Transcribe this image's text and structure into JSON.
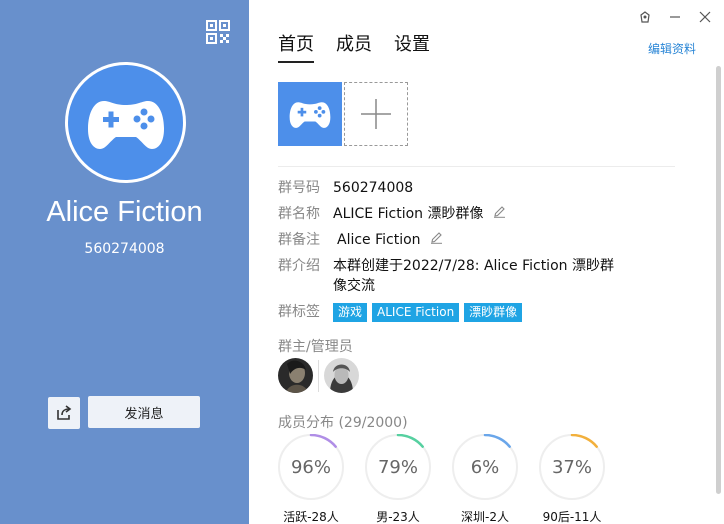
{
  "left_panel": {
    "group_name": "Alice Fiction",
    "group_number": "560274008",
    "send_message_label": "发消息"
  },
  "tabs": [
    {
      "label": "首页",
      "active": true
    },
    {
      "label": "成员",
      "active": false
    },
    {
      "label": "设置",
      "active": false
    }
  ],
  "edit_profile_label": "编辑资料",
  "info": {
    "id_label": "群号码",
    "id_value": "560274008",
    "name_label": "群名称",
    "name_value": "ALICE Fiction 漂眇群像",
    "remark_label": "群备注",
    "remark_value": "Alice Fiction",
    "intro_label": "群介绍",
    "intro_value": "本群创建于2022/7/28:  Alice Fiction 漂眇群像交流",
    "tags_label": "群标签",
    "tags": [
      "游戏",
      "ALICE Fiction",
      "漂眇群像"
    ]
  },
  "admins_label": "群主/管理员",
  "distribution": {
    "label": "成员分布 (29/2000)",
    "items": [
      {
        "percent_text": "96%",
        "value": 0.96,
        "caption": "活跃-28人",
        "color": "#b08ee6"
      },
      {
        "percent_text": "79%",
        "value": 0.79,
        "caption": "男-23人",
        "color": "#56d0a0"
      },
      {
        "percent_text": "6%",
        "value": 0.06,
        "caption": "深圳-2人",
        "color": "#6aa6ea"
      },
      {
        "percent_text": "37%",
        "value": 0.37,
        "caption": "90后-11人",
        "color": "#f2b03c"
      }
    ]
  },
  "icons": {
    "qr": "qr-code-icon",
    "controller": "gamepad-icon",
    "share": "share-icon",
    "edit": "pencil-icon"
  },
  "colors": {
    "left_bg": "#6890cc",
    "avatar_bg": "#4d8fea",
    "tag_bg": "#1fa4e4",
    "link": "#2a86d6"
  }
}
